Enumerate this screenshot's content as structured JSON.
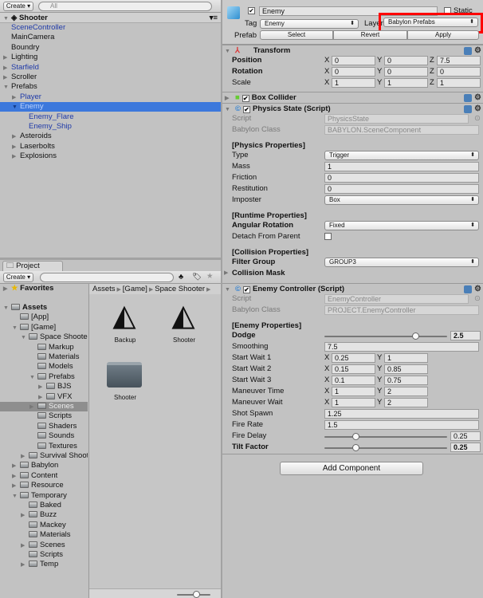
{
  "hierarchy": {
    "create": "Create",
    "search_placeholder": "All",
    "scene": "Shooter",
    "items": [
      {
        "label": "SceneController",
        "indent": 0,
        "blue": true
      },
      {
        "label": "MainCamera",
        "indent": 0
      },
      {
        "label": "Boundry",
        "indent": 0
      },
      {
        "label": "Lighting",
        "indent": 0,
        "arrow": "right"
      },
      {
        "label": "Starfield",
        "indent": 0,
        "arrow": "right",
        "blue": true
      },
      {
        "label": "Scroller",
        "indent": 0,
        "arrow": "right"
      },
      {
        "label": "Prefabs",
        "indent": 0,
        "arrow": "down"
      },
      {
        "label": "Player",
        "indent": 1,
        "arrow": "right",
        "blue": true
      },
      {
        "label": "Enemy",
        "indent": 1,
        "arrow": "down",
        "blue": true,
        "selected": true
      },
      {
        "label": "Enemy_Flare",
        "indent": 2,
        "blue": true
      },
      {
        "label": "Enemy_Ship",
        "indent": 2,
        "blue": true
      },
      {
        "label": "Asteroids",
        "indent": 1,
        "arrow": "right"
      },
      {
        "label": "Laserbolts",
        "indent": 1,
        "arrow": "right"
      },
      {
        "label": "Explosions",
        "indent": 1,
        "arrow": "right"
      }
    ]
  },
  "project": {
    "tab": "Project",
    "create": "Create",
    "favorites": "Favorites",
    "breadcrumb": [
      "Assets",
      "[Game]",
      "Space Shooter"
    ],
    "tree": [
      {
        "label": "Assets",
        "indent": 0,
        "arrow": "down",
        "bold": true
      },
      {
        "label": "[App]",
        "indent": 1
      },
      {
        "label": "[Game]",
        "indent": 1,
        "arrow": "down"
      },
      {
        "label": "Space Shooter",
        "indent": 2,
        "arrow": "down"
      },
      {
        "label": "Markup",
        "indent": 3
      },
      {
        "label": "Materials",
        "indent": 3
      },
      {
        "label": "Models",
        "indent": 3
      },
      {
        "label": "Prefabs",
        "indent": 3,
        "arrow": "down"
      },
      {
        "label": "BJS",
        "indent": 4,
        "arrow": "right"
      },
      {
        "label": "VFX",
        "indent": 4,
        "arrow": "right"
      },
      {
        "label": "Scenes",
        "indent": 3,
        "arrow": "right",
        "selected": true
      },
      {
        "label": "Scripts",
        "indent": 3
      },
      {
        "label": "Shaders",
        "indent": 3
      },
      {
        "label": "Sounds",
        "indent": 3
      },
      {
        "label": "Textures",
        "indent": 3
      },
      {
        "label": "Survival Shooter",
        "indent": 2,
        "arrow": "right"
      },
      {
        "label": "Babylon",
        "indent": 1,
        "arrow": "right"
      },
      {
        "label": "Content",
        "indent": 1,
        "arrow": "right"
      },
      {
        "label": "Resource",
        "indent": 1,
        "arrow": "right"
      },
      {
        "label": "Temporary",
        "indent": 1,
        "arrow": "down"
      },
      {
        "label": "Baked",
        "indent": 2
      },
      {
        "label": "Buzz",
        "indent": 2,
        "arrow": "right"
      },
      {
        "label": "Mackey",
        "indent": 2
      },
      {
        "label": "Materials",
        "indent": 2
      },
      {
        "label": "Scenes",
        "indent": 2,
        "arrow": "right"
      },
      {
        "label": "Scripts",
        "indent": 2
      },
      {
        "label": "Temp",
        "indent": 2,
        "arrow": "right"
      }
    ],
    "assets": [
      {
        "label": "Backup",
        "icon": "unity-scene-icon"
      },
      {
        "label": "Shooter",
        "icon": "unity-scene-icon"
      },
      {
        "label": "Shooter",
        "icon": "folder-icon"
      }
    ]
  },
  "inspector": {
    "name": "Enemy",
    "static": "Static",
    "tag_label": "Tag",
    "tag": "Enemy",
    "layer_label": "Layer",
    "layer": "Babylon Prefabs",
    "prefab_label": "Prefab",
    "select": "Select",
    "revert": "Revert",
    "apply": "Apply",
    "highlight_color": "#ff0000",
    "transform": {
      "title": "Transform",
      "rows": [
        {
          "label": "Position",
          "bold": true,
          "x": "0",
          "y": "0",
          "z": "7.5"
        },
        {
          "label": "Rotation",
          "bold": true,
          "x": "0",
          "y": "0",
          "z": "0"
        },
        {
          "label": "Scale",
          "x": "1",
          "y": "1",
          "z": "1"
        }
      ]
    },
    "box_collider": "Box Collider",
    "physics": {
      "title": "Physics State (Script)",
      "rows": [
        {
          "label": "Script",
          "kind": "ro",
          "value": "PhysicsState"
        },
        {
          "label": "Babylon Class",
          "kind": "ro",
          "value": "BABYLON.SceneComponent"
        },
        {
          "label": "[Physics Properties]",
          "kind": "header"
        },
        {
          "label": "Type",
          "kind": "drop",
          "value": "Trigger"
        },
        {
          "label": "Mass",
          "kind": "field",
          "value": "1"
        },
        {
          "label": "Friction",
          "kind": "field",
          "value": "0"
        },
        {
          "label": "Restitution",
          "kind": "field",
          "value": "0"
        },
        {
          "label": "Imposter",
          "kind": "drop",
          "value": "Box"
        },
        {
          "label": "[Runtime Properties]",
          "kind": "header"
        },
        {
          "label": "Angular Rotation",
          "kind": "drop",
          "value": "Fixed",
          "bold": true
        },
        {
          "label": "Detach From Parent",
          "kind": "check"
        },
        {
          "label": "[Collision Properties]",
          "kind": "header"
        },
        {
          "label": "Filter Group",
          "kind": "drop",
          "value": "GROUP3",
          "bold": true
        },
        {
          "label": "Collision Mask",
          "kind": "fold",
          "bold": true
        }
      ]
    },
    "enemy": {
      "title": "Enemy Controller (Script)",
      "rows": [
        {
          "label": "Script",
          "kind": "ro",
          "value": "EnemyController"
        },
        {
          "label": "Babylon Class",
          "kind": "ro",
          "value": "PROJECT.EnemyController"
        },
        {
          "label": "[Enemy Properties]",
          "kind": "header"
        },
        {
          "label": "Dodge",
          "kind": "slider",
          "value": "2.5",
          "fraction": 0.74,
          "bold": true
        },
        {
          "label": "Smoothing",
          "kind": "field",
          "value": "7.5"
        },
        {
          "label": "Start Wait 1",
          "kind": "xy",
          "x": "0.25",
          "y": "1"
        },
        {
          "label": "Start Wait 2",
          "kind": "xy",
          "x": "0.15",
          "y": "0.85"
        },
        {
          "label": "Start Wait 3",
          "kind": "xy",
          "x": "0.1",
          "y": "0.75"
        },
        {
          "label": "Maneuver Time",
          "kind": "xy",
          "x": "1",
          "y": "2"
        },
        {
          "label": "Maneuver Wait",
          "kind": "xy",
          "x": "1",
          "y": "2"
        },
        {
          "label": "Shot Spawn",
          "kind": "field",
          "value": "1.25"
        },
        {
          "label": "Fire Rate",
          "kind": "field",
          "value": "1.5"
        },
        {
          "label": "Fire Delay",
          "kind": "slider",
          "value": "0.25",
          "fraction": 0.25
        },
        {
          "label": "Tilt Factor",
          "kind": "slider",
          "value": "0.25",
          "fraction": 0.25,
          "bold": true
        }
      ]
    },
    "add_component": "Add Component"
  }
}
